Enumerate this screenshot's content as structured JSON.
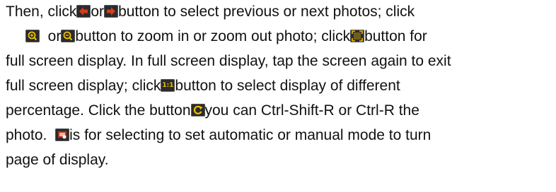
{
  "lines": [
    [
      "Then, click",
      "or",
      "button to select previous or next photos; click"
    ],
    [
      "or",
      "button to zoom in or zoom out photo; click",
      "button for"
    ],
    [
      "full screen display. In full screen display, tap the screen again to exit"
    ],
    [
      "full screen display; click",
      "button to select display of different"
    ],
    [
      "percentage. Click the button",
      "you can Ctrl-Shift-R or Ctrl-R the"
    ],
    [
      "photo.",
      "is for selecting to set automatic or manual mode to turn"
    ],
    [
      "page of display."
    ]
  ],
  "icons": {
    "prev": "arrow-left-icon",
    "next": "arrow-right-icon",
    "zoom_in": "zoom-in-icon",
    "zoom_out": "zoom-out-icon",
    "full_screen": "full-screen-icon",
    "ratio_label": "1:1",
    "rotate": "rotate-icon",
    "slideshow": "slideshow-icon"
  },
  "colors": {
    "icon_bg": "#2b2b2b",
    "icon_accent": "#f0c000",
    "icon_red": "#d83a1a",
    "text": "#111111"
  }
}
